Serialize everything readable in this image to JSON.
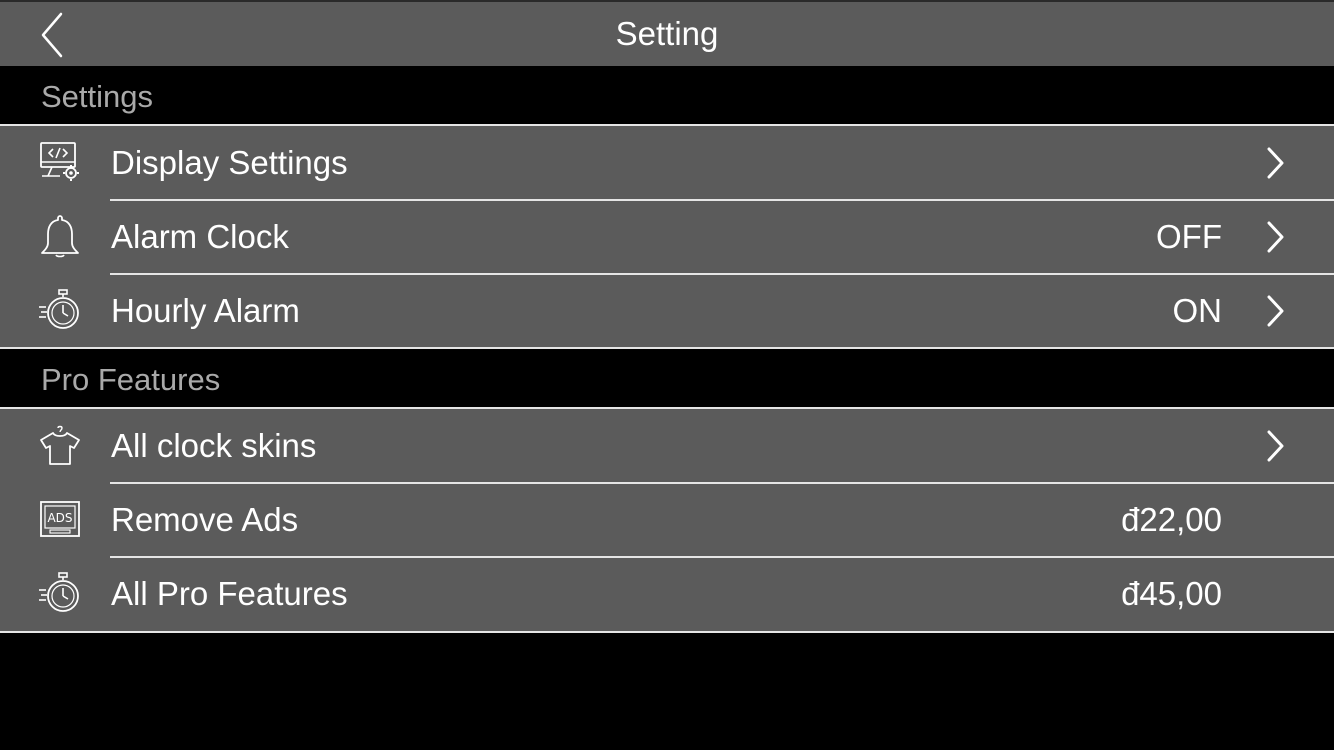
{
  "header": {
    "title": "Setting",
    "back_icon": "chevron-left-icon"
  },
  "sections": [
    {
      "title": "Settings",
      "rows": [
        {
          "label": "Display Settings",
          "value": "",
          "icon": "monitor-settings-icon",
          "has_chevron": true
        },
        {
          "label": "Alarm Clock",
          "value": "OFF",
          "icon": "bell-icon",
          "has_chevron": true
        },
        {
          "label": "Hourly Alarm",
          "value": "ON",
          "icon": "stopwatch-icon",
          "has_chevron": true
        }
      ]
    },
    {
      "title": "Pro Features",
      "rows": [
        {
          "label": "All clock skins",
          "value": "",
          "icon": "tshirt-icon",
          "has_chevron": true
        },
        {
          "label": "Remove Ads",
          "value": "đ22,00",
          "icon": "ads-icon",
          "has_chevron": false
        },
        {
          "label": "All Pro Features",
          "value": "đ45,00",
          "icon": "stopwatch-icon",
          "has_chevron": false
        }
      ]
    }
  ],
  "colors": {
    "background": "#000000",
    "row_background": "#5b5b5b",
    "separator": "#e5e5e5",
    "section_header_text": "#a9a9a9",
    "text": "#ffffff"
  }
}
